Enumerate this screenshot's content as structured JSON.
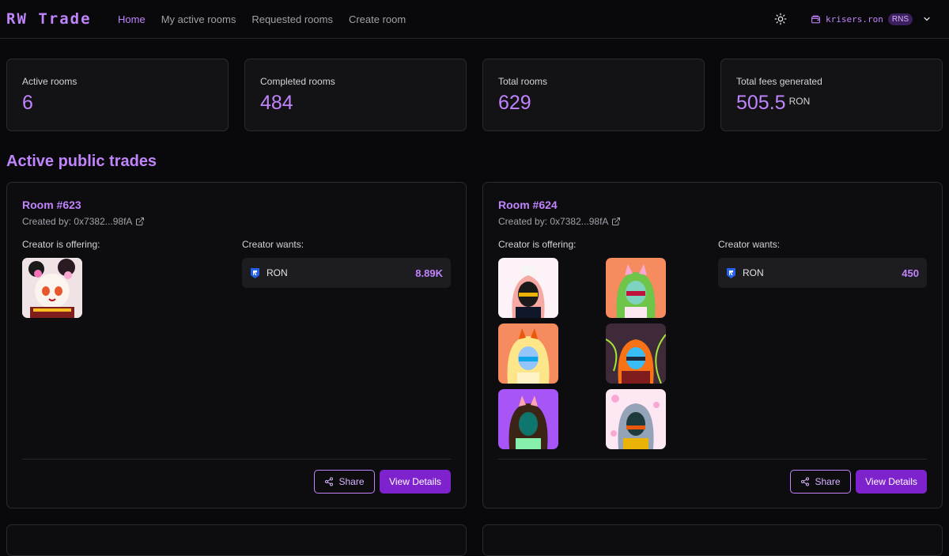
{
  "app": {
    "logo": "RW Trade"
  },
  "nav": {
    "links": [
      {
        "label": "Home",
        "active": true
      },
      {
        "label": "My active rooms"
      },
      {
        "label": "Requested rooms"
      },
      {
        "label": "Create room"
      }
    ],
    "wallet": {
      "name": "krisers.ron",
      "badge": "RNS"
    }
  },
  "stats": [
    {
      "label": "Active rooms",
      "value": "6",
      "unit": ""
    },
    {
      "label": "Completed rooms",
      "value": "484",
      "unit": ""
    },
    {
      "label": "Total rooms",
      "value": "629",
      "unit": ""
    },
    {
      "label": "Total fees generated",
      "value": "505.5",
      "unit": "RON"
    }
  ],
  "section": {
    "title": "Active public trades"
  },
  "rooms": [
    {
      "title": "Room #623",
      "created_by": "Created by: 0x7382...98fA",
      "offer_label": "Creator is offering:",
      "wants_label": "Creator wants:",
      "nft_count": 1,
      "wants": {
        "token": "RON",
        "amount": "8.89K"
      },
      "share_label": "Share",
      "view_label": "View Details"
    },
    {
      "title": "Room #624",
      "created_by": "Created by: 0x7382...98fA",
      "offer_label": "Creator is offering:",
      "wants_label": "Creator wants:",
      "nft_count": 6,
      "wants": {
        "token": "RON",
        "amount": "450"
      },
      "share_label": "Share",
      "view_label": "View Details"
    }
  ],
  "colors": {
    "accent": "#c084fc",
    "button": "#7e22ce",
    "background": "#09090b"
  }
}
